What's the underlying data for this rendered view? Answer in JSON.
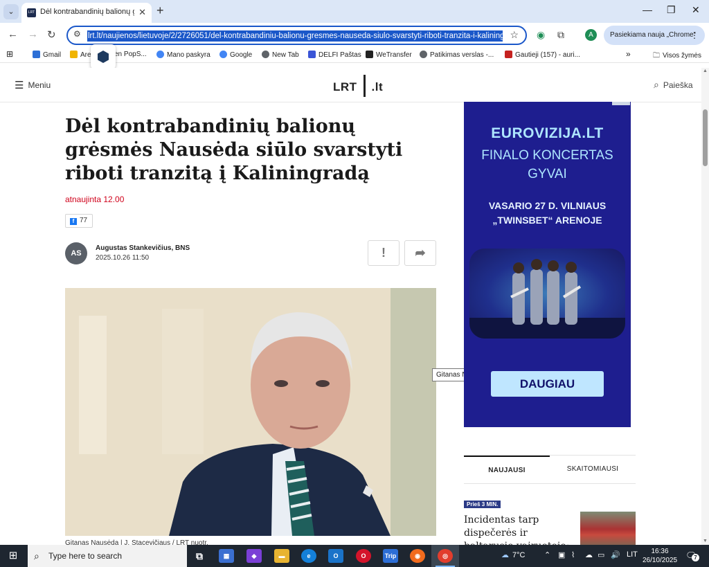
{
  "browser": {
    "tab_title": "Dėl kontrabandinių balionų grė",
    "url": "lrt.lt/naujienos/lietuvoje/2/2726051/del-kontrabandiniu-balionu-gresmes-nauseda-siulo-svarstyti-riboti-tranzita-i-kalining",
    "update_label": "Pasiekiama nauja „Chrome“",
    "profile_initial": "A",
    "icons": [
      "tab-search-icon",
      "close-icon",
      "plus-icon",
      "back-icon",
      "forward-icon",
      "reload-icon",
      "site-settings-icon",
      "star-icon",
      "extensions-icon",
      "more-icon"
    ],
    "bookmarks": [
      {
        "label": "Gmail",
        "color": "#2d6fd6"
      },
      {
        "label": "Are",
        "color": "#f0b400"
      },
      {
        "label": "en PopS...",
        "color": "#d13c2f"
      },
      {
        "label": "Mano paskyra",
        "color": "#4285f4"
      },
      {
        "label": "Google",
        "color": "#4285f4"
      },
      {
        "label": "New Tab",
        "color": "#5f6368"
      },
      {
        "label": "DELFI Paštas",
        "color": "#3a55d6"
      },
      {
        "label": "WeTransfer",
        "color": "#222222"
      },
      {
        "label": "Patikimas verslas -...",
        "color": "#5f6368"
      },
      {
        "label": "Gautieji (157) - auri...",
        "color": "#c5221f"
      }
    ],
    "all_bookmarks_label": "Visos žymės"
  },
  "site": {
    "menu_label": "Meniu",
    "logo_left": "LRT",
    "logo_right": ".lt",
    "search_label": "Paieška"
  },
  "article": {
    "headline": "Dėl kontrabandinių balionų grėsmės Nausėda siūlo svarstyti riboti tranzitą į Kaliningradą",
    "updated": "atnaujinta 12.00",
    "fb_count": "77",
    "author_initials": "AS",
    "author": "Augustas Stankevičius, BNS",
    "date": "2025.10.26 11:50",
    "report_label": "!",
    "share_label": "➦",
    "photo_tooltip": "Gitanas Nausėda",
    "caption": "Gitanas Nausėda | J. Stacevičiaus / LRT nuotr."
  },
  "ad": {
    "brand": "EUROVIZIJA.LT",
    "line1": "FINALO KONCERTAS",
    "line2": "GYVAI",
    "date_line1": "VASARIO 27 D. VILNIAUS",
    "date_line2": "„TWINSBET“ ARENOJE",
    "cta": "DAUGIAU"
  },
  "sidebar": {
    "tabs": [
      "NAUJAUSI",
      "SKAITOMIAUSI"
    ],
    "active_tab": "NAUJAUSI",
    "news": [
      {
        "badge": "Prieš 3 MIN.",
        "title": "Incidentas tarp dispečerės ir baltarusio vairuotojo: jos užduotis"
      }
    ]
  },
  "taskbar": {
    "search_placeholder": "Type here to search",
    "weather": "7°C",
    "lang": "LIT",
    "time": "16:36",
    "date": "26/10/2025",
    "notifications": "7"
  },
  "colors": {
    "accent_blue": "#1a57c9",
    "updated_red": "#d0021b",
    "ad_bg": "#1e1e8f",
    "ad_text": "#aee6ff"
  }
}
